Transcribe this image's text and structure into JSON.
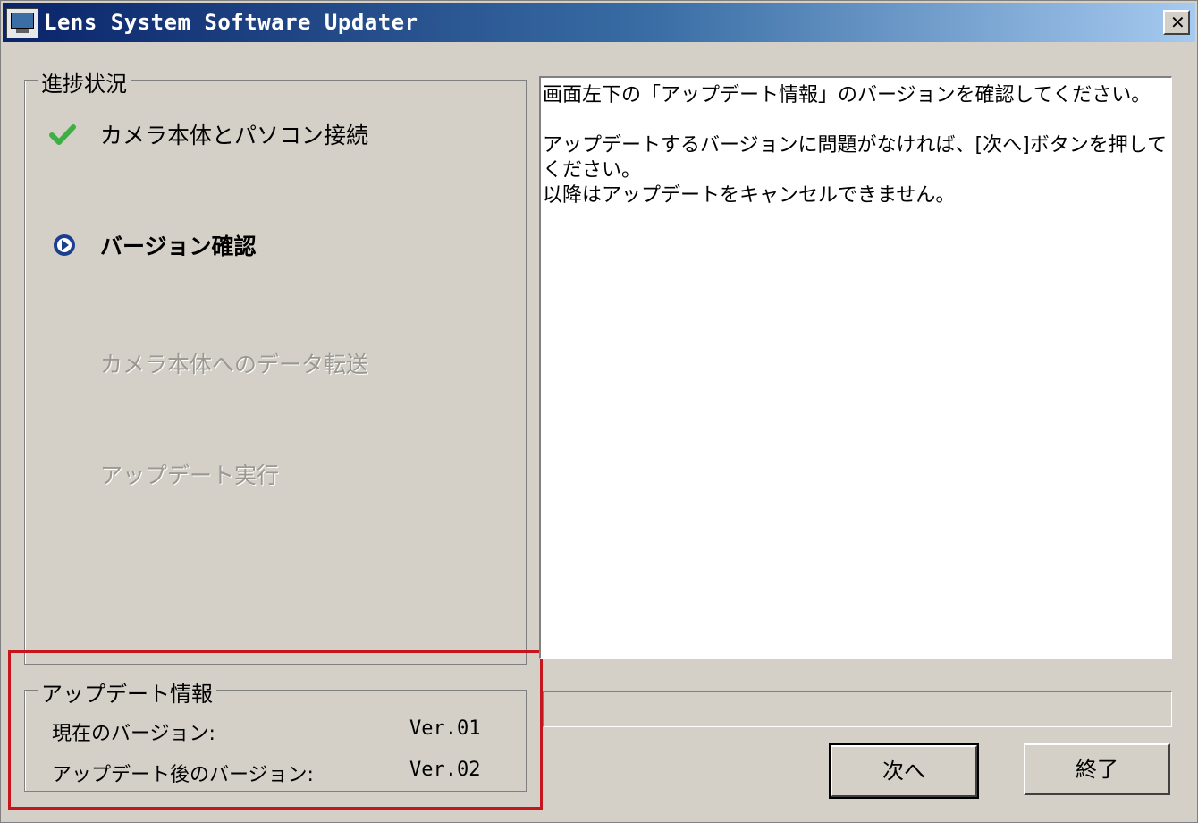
{
  "window": {
    "title": "Lens System Software Updater",
    "close_label": "✕"
  },
  "progress": {
    "label": "進捗状況",
    "steps": [
      {
        "label": "カメラ本体とパソコン接続",
        "state": "done"
      },
      {
        "label": "バージョン確認",
        "state": "current"
      },
      {
        "label": "カメラ本体へのデータ転送",
        "state": "pending"
      },
      {
        "label": "アップデート実行",
        "state": "pending"
      }
    ]
  },
  "update_info": {
    "label": "アップデート情報",
    "current_version_label": "現在のバージョン:",
    "current_version_value": "Ver.01",
    "new_version_label": "アップデート後のバージョン:",
    "new_version_value": "Ver.02"
  },
  "message": {
    "line1": "画面左下の「アップデート情報」のバージョンを確認してください。",
    "line2": "アップデートするバージョンに問題がなければ、[次へ]ボタンを押してください。",
    "line3": "以降はアップデートをキャンセルできません。"
  },
  "progress_bar": {
    "fraction": 0
  },
  "buttons": {
    "next_label": "次へ",
    "exit_label": "終了"
  },
  "colors": {
    "check": "#3cb043",
    "current_step": "#1b3f8f",
    "highlight": "#c4161c"
  },
  "icons": {
    "done": "check-icon",
    "current": "play-circle-icon"
  }
}
